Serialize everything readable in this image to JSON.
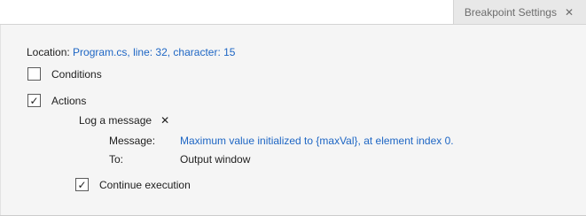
{
  "tab": {
    "title": "Breakpoint Settings",
    "close_icon": "close-icon"
  },
  "location": {
    "label": "Location:",
    "value": "Program.cs, line: 32, character: 15"
  },
  "conditions": {
    "label": "Conditions",
    "checked": false
  },
  "actions": {
    "label": "Actions",
    "checked": true,
    "check_glyph": "✓"
  },
  "action_item": {
    "type_label": "Log a message",
    "remove_glyph": "✕",
    "message_label": "Message:",
    "message_value": "Maximum value initialized to {maxVal}, at element index 0.",
    "to_label": "To:",
    "to_value": "Output window"
  },
  "continue_execution": {
    "label": "Continue execution",
    "checked": true,
    "check_glyph": "✓"
  },
  "colors": {
    "link": "#1e66c4",
    "panel_bg": "#f5f5f5",
    "tab_bg": "#e8e8e8"
  }
}
